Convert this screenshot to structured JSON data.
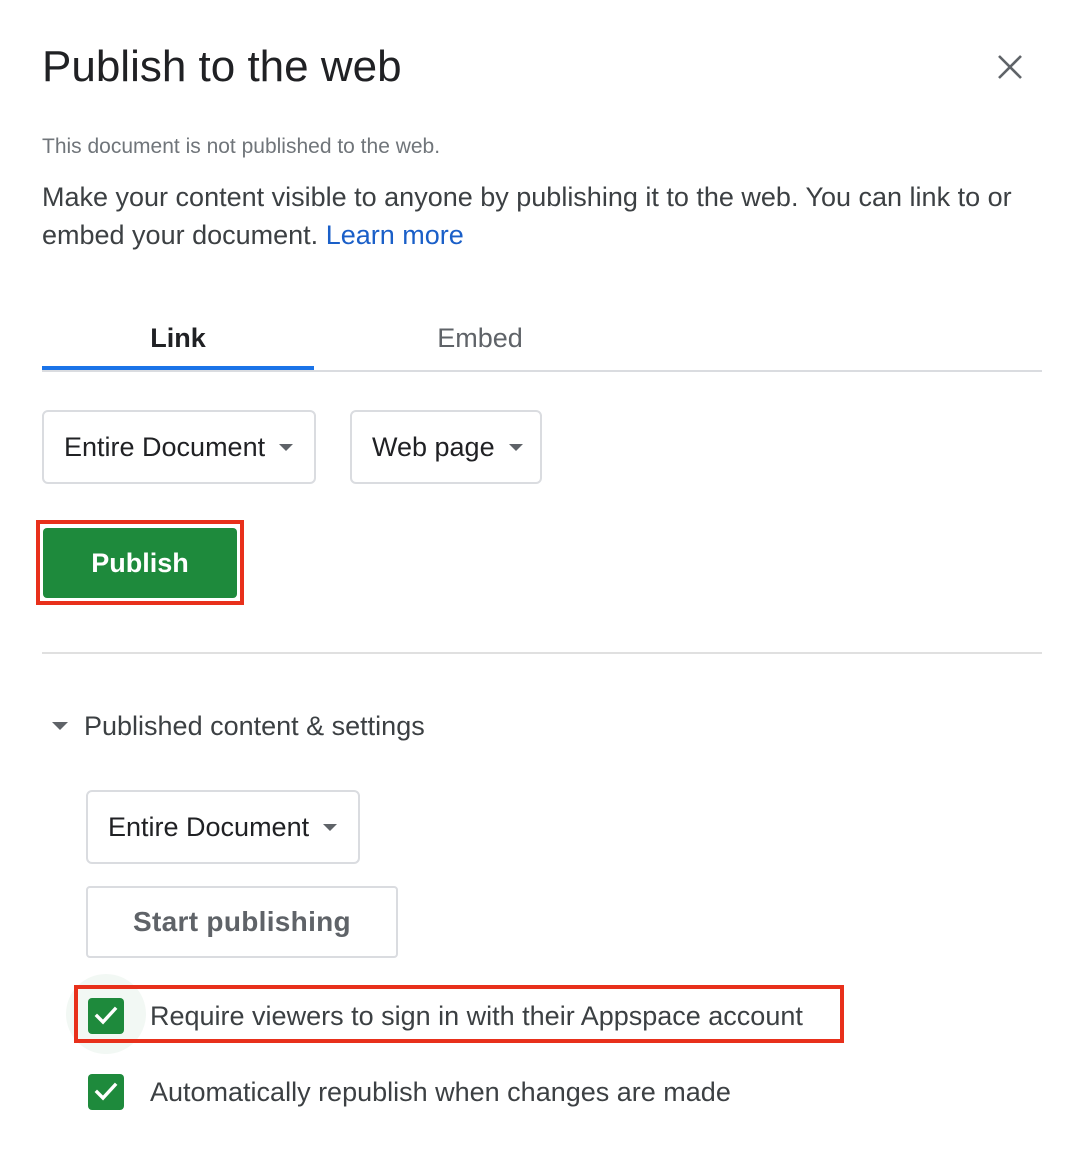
{
  "dialog": {
    "title": "Publish to the web",
    "status": "This document is not published to the web.",
    "description": "Make your content visible to anyone by publishing it to the web. You can link to or embed your document.",
    "learn_more": "Learn more"
  },
  "tabs": [
    {
      "label": "Link",
      "active": true
    },
    {
      "label": "Embed",
      "active": false
    }
  ],
  "link_options": {
    "scope": "Entire Document",
    "format": "Web page"
  },
  "publish_button": "Publish",
  "published_settings": {
    "header": "Published content & settings",
    "scope": "Entire Document",
    "start_button": "Start publishing",
    "options": [
      {
        "label": "Require viewers to sign in with their Appspace account",
        "checked": true
      },
      {
        "label": "Automatically republish when changes are made",
        "checked": true
      }
    ]
  },
  "colors": {
    "primary_green": "#1e8a3c",
    "tab_accent": "#1a73e8",
    "link": "#1a5fc8",
    "highlight": "#e8301b"
  }
}
